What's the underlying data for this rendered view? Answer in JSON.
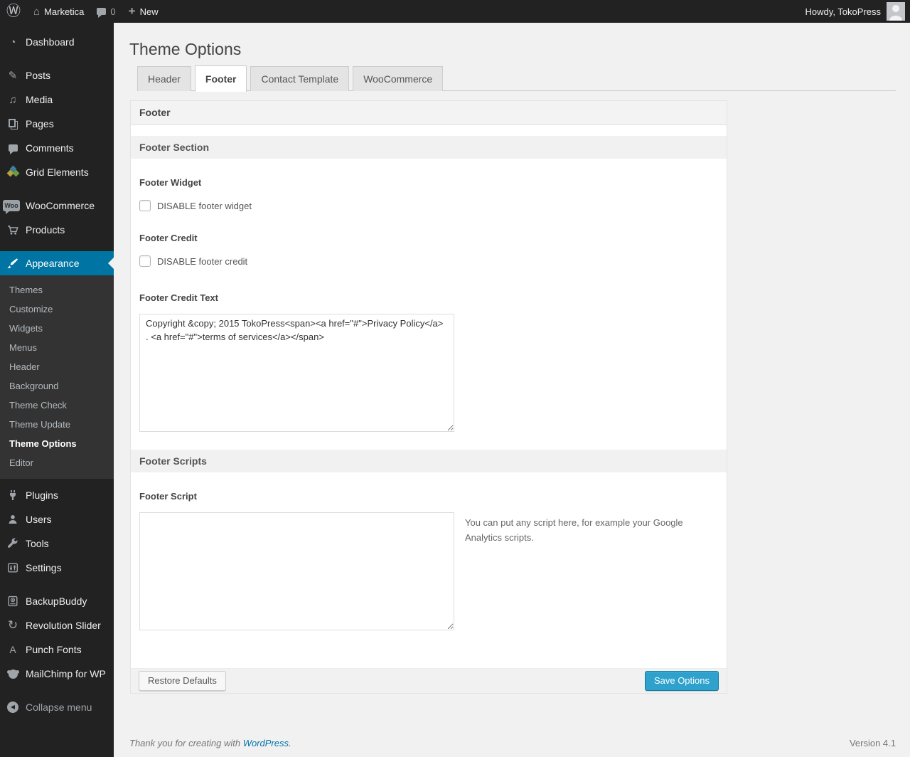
{
  "admin_bar": {
    "site_name": "Marketica",
    "comment_count": "0",
    "new_label": "New",
    "howdy": "Howdy, TokoPress"
  },
  "icons": {
    "wp_logo": "Ⓦ",
    "home": "⌂",
    "new_plus": "+",
    "dashboard": "◔",
    "posts": "✎",
    "media": "♫",
    "revolution_slider": "↻",
    "punch_fonts": "A",
    "collapse_arrow": "◀",
    "woo_badge": "Woo"
  },
  "sidebar": {
    "items": [
      {
        "label": "Dashboard"
      },
      {
        "label": "Posts"
      },
      {
        "label": "Media"
      },
      {
        "label": "Pages"
      },
      {
        "label": "Comments"
      },
      {
        "label": "Grid Elements"
      },
      {
        "label": "WooCommerce"
      },
      {
        "label": "Products"
      },
      {
        "label": "Appearance"
      },
      {
        "label": "Plugins"
      },
      {
        "label": "Users"
      },
      {
        "label": "Tools"
      },
      {
        "label": "Settings"
      },
      {
        "label": "BackupBuddy"
      },
      {
        "label": "Revolution Slider"
      },
      {
        "label": "Punch Fonts"
      },
      {
        "label": "MailChimp for WP"
      },
      {
        "label": "Collapse menu"
      }
    ],
    "appearance_submenu": [
      "Themes",
      "Customize",
      "Widgets",
      "Menus",
      "Header",
      "Background",
      "Theme Check",
      "Theme Update",
      "Theme Options",
      "Editor"
    ]
  },
  "page": {
    "title": "Theme Options"
  },
  "tabs": [
    {
      "label": "Header"
    },
    {
      "label": "Footer"
    },
    {
      "label": "Contact Template"
    },
    {
      "label": "WooCommerce"
    }
  ],
  "panel": {
    "heading": "Footer",
    "section_footer_title": "Footer Section",
    "section_scripts_title": "Footer Scripts",
    "fields": {
      "footer_widget_label": "Footer Widget",
      "footer_widget_checkbox": "DISABLE footer widget",
      "footer_credit_label": "Footer Credit",
      "footer_credit_checkbox": "DISABLE footer credit",
      "footer_credit_text_label": "Footer Credit Text",
      "footer_credit_text_value": "Copyright &copy; 2015 TokoPress<span><a href=\"#\">Privacy Policy</a> . <a href=\"#\">terms of services</a></span>",
      "footer_script_label": "Footer Script",
      "footer_script_value": "",
      "footer_script_help": "You can put any script here, for example your Google Analytics scripts."
    },
    "buttons": {
      "restore": "Restore Defaults",
      "save": "Save Options"
    }
  },
  "footer": {
    "thanks_prefix": "Thank you for creating with",
    "wordpress_link": "WordPress.",
    "version": "Version 4.1"
  },
  "colors": {
    "accent": "#0074a2",
    "primary_button": "#2ea2cc",
    "link": "#0073aa",
    "menu_bg": "#222222"
  }
}
